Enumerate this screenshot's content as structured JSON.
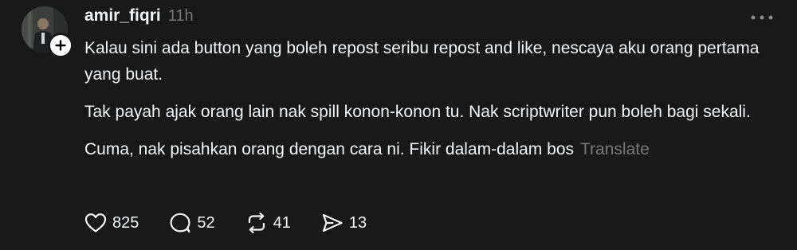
{
  "post": {
    "author": "amir_fiqri",
    "timestamp": "11h",
    "paragraphs": [
      "Kalau sini ada button yang boleh repost seribu repost and like, nescaya aku orang pertama yang buat.",
      "Tak payah ajak orang lain nak spill konon-konon tu. Nak scriptwriter pun boleh bagi sekali.",
      "Cuma, nak pisahkan orang dengan cara ni. Fikir dalam-dalam bos"
    ],
    "translate_label": "Translate",
    "stats": {
      "likes": "825",
      "replies": "52",
      "reposts": "41",
      "shares": "13"
    }
  },
  "icons": {
    "avatar": "avatar-photo",
    "follow": "plus-icon",
    "more": "more-dots-icon",
    "like": "heart-icon",
    "reply": "comment-icon",
    "repost": "repost-icon",
    "share": "send-icon"
  },
  "colors": {
    "background": "#181818",
    "text": "#f3f5f7",
    "muted": "#777777"
  }
}
